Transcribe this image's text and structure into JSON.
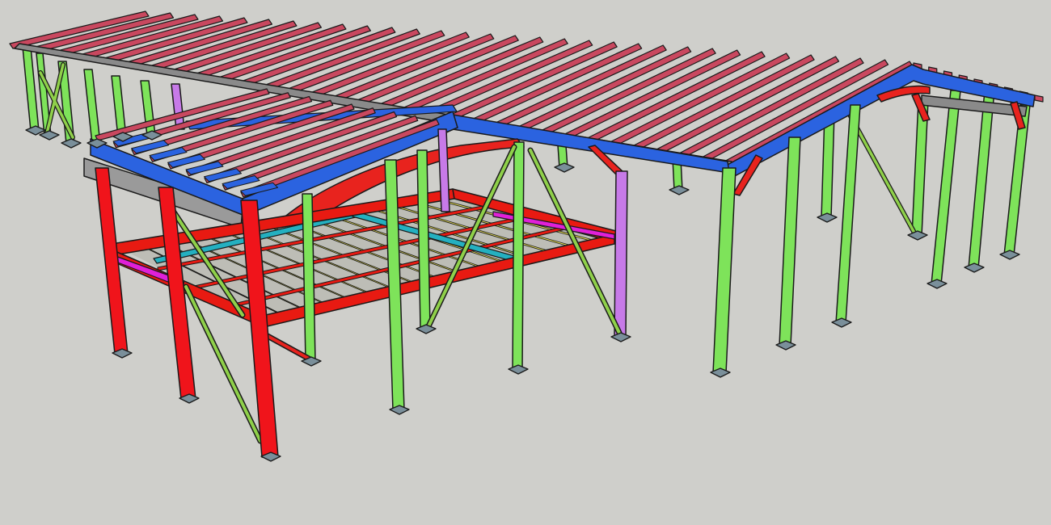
{
  "viewport": {
    "background": "#cfcfcb"
  },
  "palette": {
    "roof_purlin": "#c9485f",
    "rafter": "#2b63e0",
    "haunch": "#e8231e",
    "column": "#7ee35a",
    "front_column": "#f0141b",
    "bracing": "#8fd04a",
    "floor_beam": "#f0e85a",
    "floor_edge": "#e81a12",
    "floor_trim": "#e020d8",
    "tie_beam": "#24b0c0",
    "eave_beam": "#8a8a8a",
    "violet_column": "#c77ae8",
    "base_plate": "#7a8f9a",
    "outline": "#1a1a1a"
  },
  "model": {
    "object": "steel-frame-structure",
    "components": [
      "roof-purlins",
      "rafters",
      "haunches",
      "columns",
      "front-portal-columns",
      "cross-bracing",
      "mezzanine-floor",
      "base-plates",
      "eave-beams"
    ]
  }
}
